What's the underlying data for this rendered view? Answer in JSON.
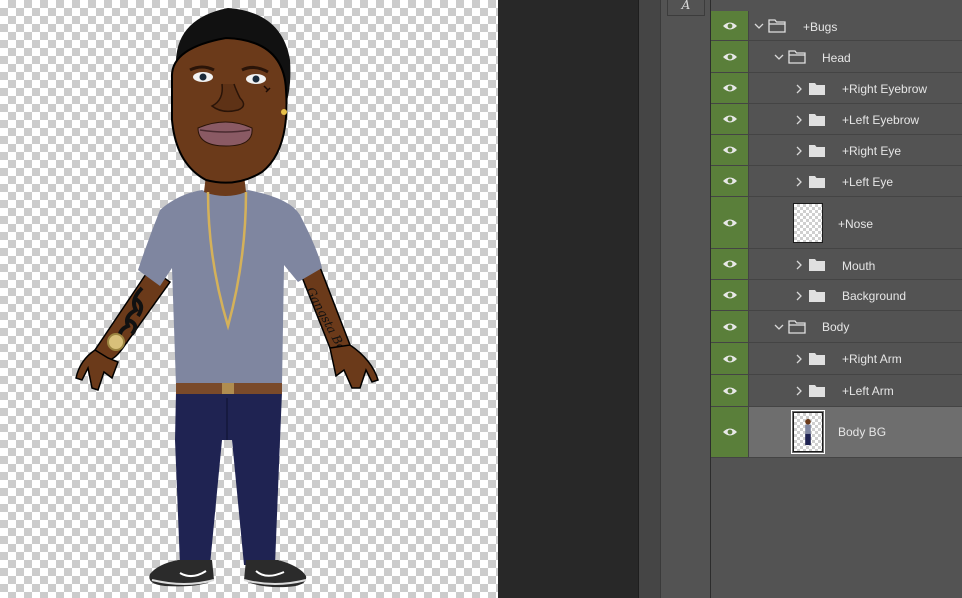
{
  "canvas": {
    "artwork": "Cartoon character illustration on transparent background",
    "arm_tattoo_text": "Gangsta Boys"
  },
  "colors": {
    "eye_column": "#5a7f3a",
    "panel_bg": "#535353",
    "selected_row": "#6e6e6e",
    "text": "#e6e6e6",
    "skin": "#6b3a1a",
    "shirt": "#7f86a0",
    "jeans": "#1f2352"
  },
  "tools": {
    "partial_tool_glyph": "A"
  },
  "layers": [
    {
      "name": "+Bugs",
      "kind": "group",
      "expanded": true,
      "icon": "folder-open-icon"
    },
    {
      "name": "Head",
      "kind": "group",
      "expanded": true,
      "icon": "folder-open-icon"
    },
    {
      "name": "+Right Eyebrow",
      "kind": "group",
      "expanded": false,
      "icon": "folder-icon"
    },
    {
      "name": "+Left Eyebrow",
      "kind": "group",
      "expanded": false,
      "icon": "folder-icon"
    },
    {
      "name": "+Right Eye",
      "kind": "group",
      "expanded": false,
      "icon": "folder-icon"
    },
    {
      "name": "+Left Eye",
      "kind": "group",
      "expanded": false,
      "icon": "folder-icon"
    },
    {
      "name": "+Nose",
      "kind": "layer",
      "icon": "transparent-thumbnail"
    },
    {
      "name": "Mouth",
      "kind": "group",
      "expanded": false,
      "icon": "folder-icon"
    },
    {
      "name": "Background",
      "kind": "group",
      "expanded": false,
      "icon": "folder-icon"
    },
    {
      "name": "Body",
      "kind": "group",
      "expanded": true,
      "icon": "folder-open-icon"
    },
    {
      "name": "+Right Arm",
      "kind": "group",
      "expanded": false,
      "icon": "folder-icon"
    },
    {
      "name": "+Left Arm",
      "kind": "group",
      "expanded": false,
      "icon": "folder-icon"
    },
    {
      "name": "Body BG",
      "kind": "layer",
      "selected": true,
      "icon": "figure-thumbnail"
    }
  ]
}
